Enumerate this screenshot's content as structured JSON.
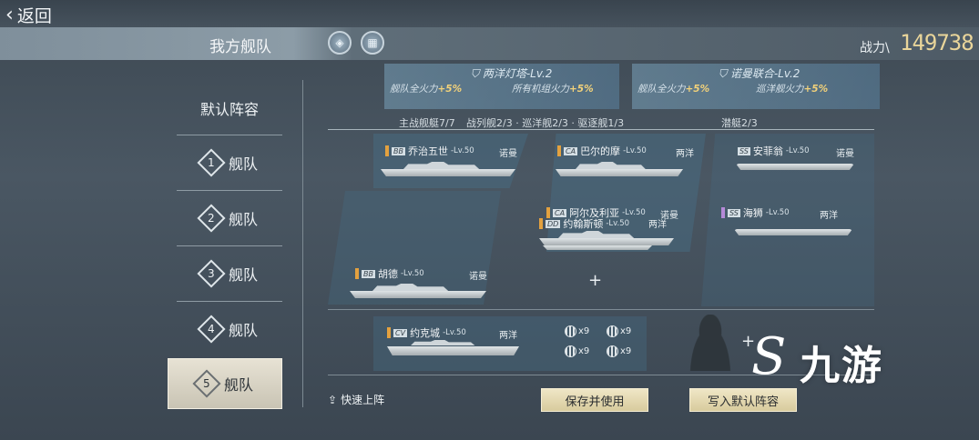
{
  "header": {
    "back_label": "返回",
    "title": "我方舰队",
    "power_label": "战力\\",
    "power_value": "149738",
    "emblem_icons": [
      "shield-emblem-icon",
      "trident-emblem-icon"
    ]
  },
  "sidebar": {
    "default_label": "默认阵容",
    "fleets": [
      {
        "num": "1",
        "label": "舰队"
      },
      {
        "num": "2",
        "label": "舰队"
      },
      {
        "num": "3",
        "label": "舰队"
      },
      {
        "num": "4",
        "label": "舰队"
      },
      {
        "num": "5",
        "label": "舰队"
      }
    ]
  },
  "bonuses": [
    {
      "title": "两洋灯塔-Lv.2",
      "effect1": "舰队全火力",
      "effect1_val": "+5%",
      "effect2": "所有机组火力",
      "effect2_val": "+5%"
    },
    {
      "title": "诺曼联合-Lv.2",
      "effect1": "舰队全火力",
      "effect1_val": "+5%",
      "effect2": "巡洋舰火力",
      "effect2_val": "+5%"
    }
  ],
  "slot_header": {
    "main": "主战舰艇7/7",
    "detail": "战列舰2/3 · 巡洋舰2/3 · 驱逐舰1/3",
    "sub": "潜艇2/3"
  },
  "ships": {
    "s1": {
      "name": "乔治五世",
      "lv": "-Lv.50",
      "faction": "诺曼"
    },
    "s2": {
      "name": "胡德",
      "lv": "-Lv.50",
      "faction": "诺曼"
    },
    "s3": {
      "name": "巴尔的摩",
      "lv": "-Lv.50",
      "faction": "两洋"
    },
    "s4": {
      "name": "阿尔及利亚",
      "lv": "-Lv.50",
      "faction": "诺曼"
    },
    "s5": {
      "name": "约翰斯顿",
      "lv": "-Lv.50",
      "faction": "两洋"
    },
    "s6": {
      "name": "约克城",
      "lv": "-Lv.50",
      "faction": "两洋"
    },
    "s7": {
      "name": "安菲翁",
      "lv": "-Lv.50",
      "faction": "诺曼"
    },
    "s8": {
      "name": "海狮",
      "lv": "-Lv.50",
      "faction": "两洋"
    }
  },
  "aircraft": [
    {
      "icon": "fighter-icon",
      "count": "x9"
    },
    {
      "icon": "bomber-icon",
      "count": "x9"
    },
    {
      "icon": "torpedo-bomber-icon",
      "count": "x9"
    },
    {
      "icon": "scout-icon",
      "count": "x9"
    }
  ],
  "actions": {
    "quick": "快速上阵",
    "save": "保存并使用",
    "write_default": "写入默认阵容"
  },
  "watermark": "九游"
}
